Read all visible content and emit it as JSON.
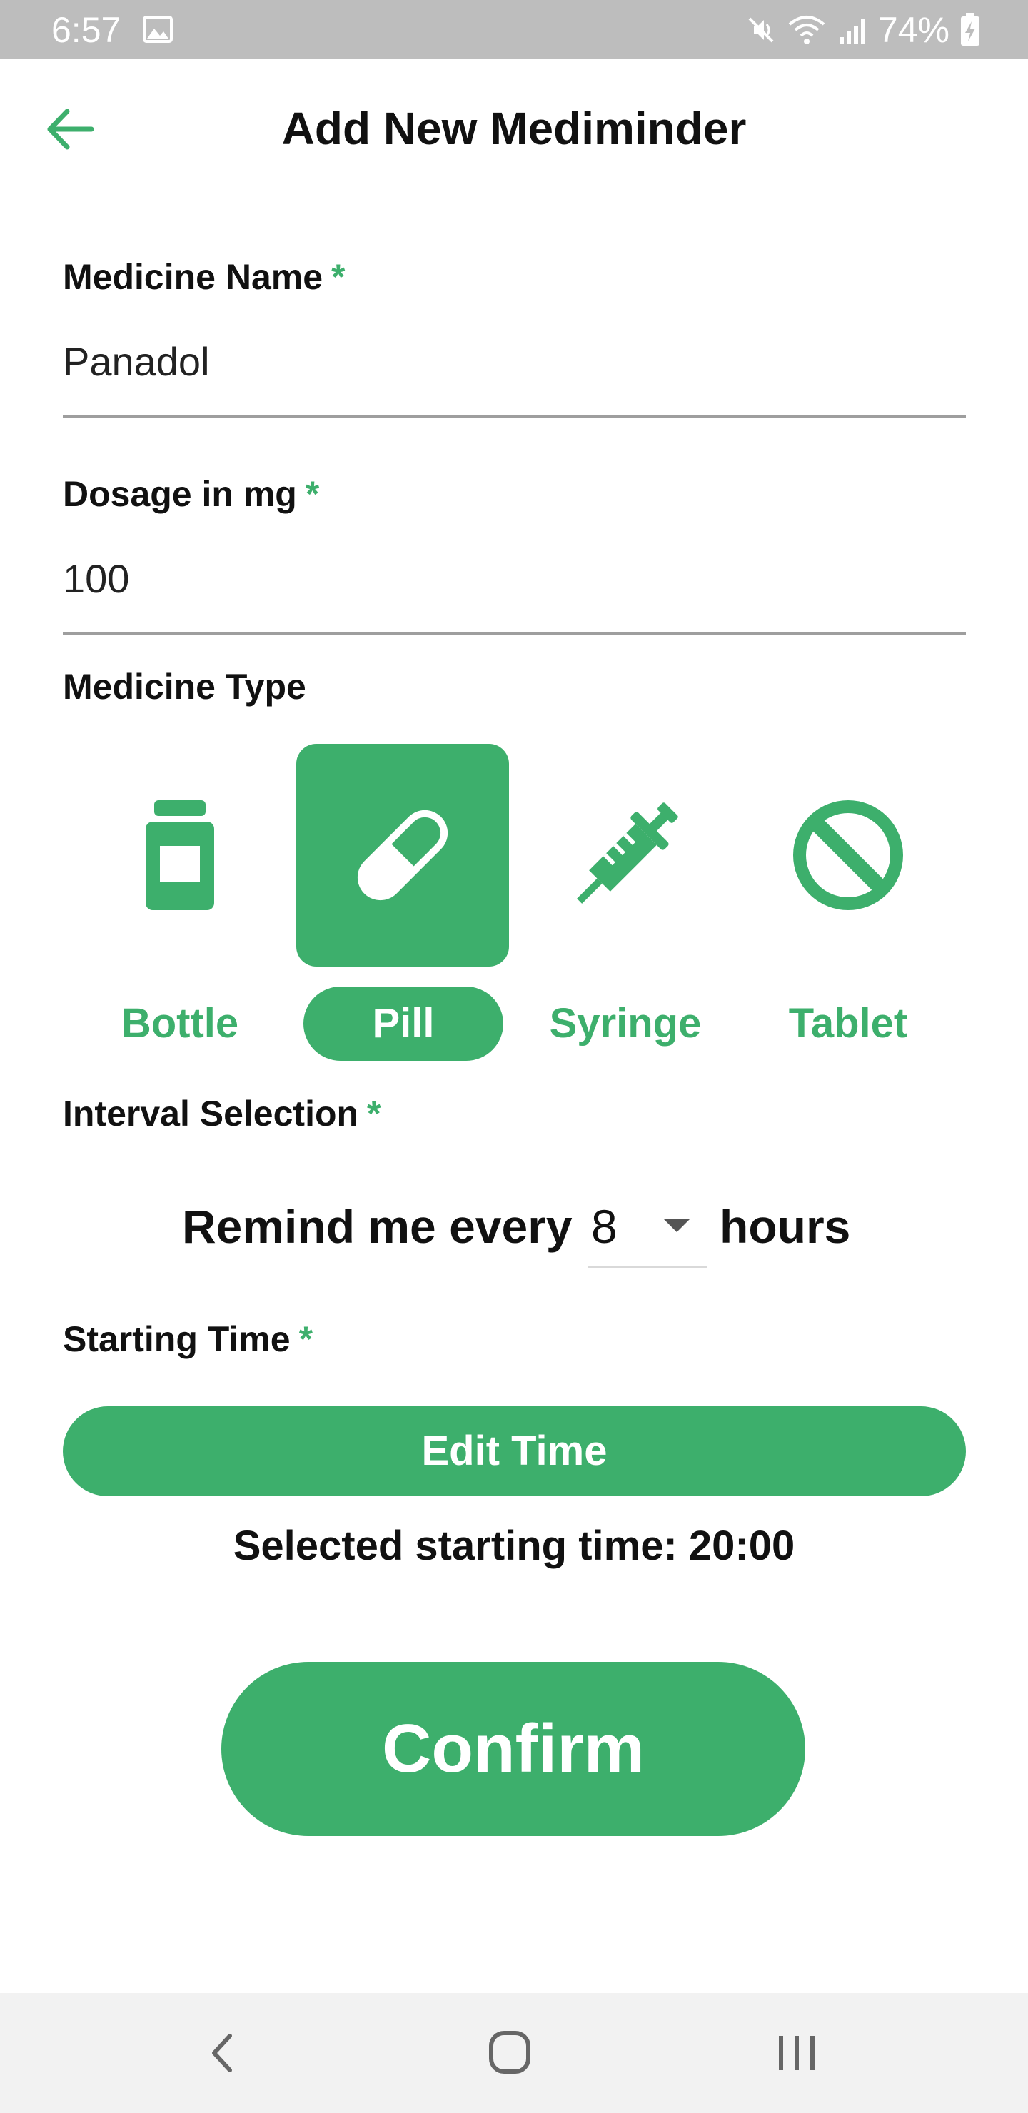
{
  "status_bar": {
    "time": "6:57",
    "battery_text": "74%",
    "icons": [
      "gallery-icon",
      "mute-icon",
      "wifi-icon",
      "signal-icon",
      "battery-charging-icon"
    ]
  },
  "app_bar": {
    "title": "Add New Mediminder",
    "back_icon": "arrow-left-icon"
  },
  "form": {
    "medicine_name": {
      "label": "Medicine Name",
      "required_mark": "*",
      "value": "Panadol"
    },
    "dosage": {
      "label": "Dosage in mg",
      "required_mark": "*",
      "value": "100"
    },
    "medicine_type": {
      "label": "Medicine Type",
      "selected": "Pill",
      "options": [
        {
          "label": "Bottle",
          "icon": "bottle-icon"
        },
        {
          "label": "Pill",
          "icon": "pill-icon"
        },
        {
          "label": "Syringe",
          "icon": "syringe-icon"
        },
        {
          "label": "Tablet",
          "icon": "tablet-icon"
        }
      ]
    },
    "interval": {
      "label": "Interval Selection",
      "required_mark": "*",
      "prefix": "Remind me every",
      "value": "8",
      "suffix": "hours"
    },
    "starting_time": {
      "label": "Starting Time",
      "required_mark": "*",
      "button_label": "Edit Time",
      "selected_text": "Selected starting time: 20:00"
    }
  },
  "confirm_label": "Confirm",
  "colors": {
    "accent": "#3daf6c",
    "status_bar": "#bdbdbd",
    "nav_bar": "#f2f2f2"
  },
  "nav_bar": {
    "icons": [
      "back-icon",
      "home-icon",
      "recents-icon"
    ]
  }
}
